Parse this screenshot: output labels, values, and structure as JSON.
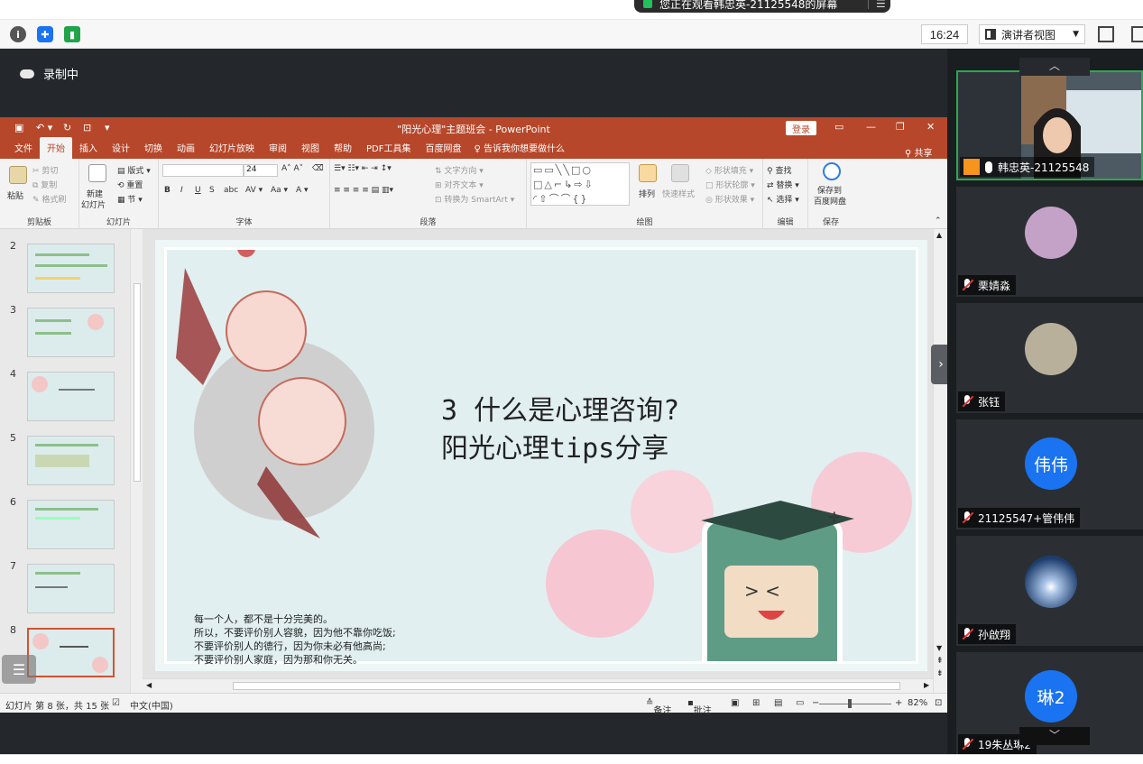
{
  "banner": {
    "text": "您正在观看韩忠英-21125548的屏幕"
  },
  "toolbar": {
    "time": "16:24",
    "view_mode": "演讲者视图"
  },
  "recording": {
    "label": "录制中"
  },
  "ppt": {
    "title": "\"阳光心理\"主题班会  -  PowerPoint",
    "login": "登录",
    "share": "共享",
    "tell_me": "告诉我你想要做什么",
    "tabs": [
      "文件",
      "开始",
      "插入",
      "设计",
      "切换",
      "动画",
      "幻灯片放映",
      "审阅",
      "视图",
      "帮助",
      "PDF工具集",
      "百度网盘"
    ],
    "ribbon": {
      "clipboard": {
        "label": "剪贴板",
        "paste": "粘贴",
        "cut": "剪切",
        "copy": "复制",
        "format_painter": "格式刷"
      },
      "slides": {
        "label": "幻灯片",
        "new_slide": "新建",
        "new_slide2": "幻灯片",
        "layout": "版式",
        "reset": "重置",
        "section": "节"
      },
      "font": {
        "label": "字体",
        "size": "24"
      },
      "paragraph": {
        "label": "段落",
        "text_direction": "文字方向",
        "align_text": "对齐文本",
        "smartart": "转换为 SmartArt"
      },
      "drawing": {
        "label": "绘图",
        "arrange": "排列",
        "quick_styles": "快速样式",
        "shape_fill": "形状填充",
        "shape_outline": "形状轮廓",
        "shape_effects": "形状效果"
      },
      "editing": {
        "label": "编辑",
        "find": "查找",
        "replace": "替换",
        "select": "选择"
      },
      "save": {
        "label": "保存",
        "save_to": "保存到",
        "baidu": "百度网盘"
      }
    },
    "thumbnails": [
      "2",
      "3",
      "4",
      "5",
      "6",
      "7",
      "8"
    ],
    "slide": {
      "title_line1": "3 什么是心理咨询?",
      "title_line2": "阳光心理tips分享",
      "body": [
        "每一个人，都不是十分完美的。",
        "所以，不要评价别人容貌，因为他不靠你吃饭;",
        "不要评价别人的德行，因为你未必有他高尚;",
        "不要评价别人家庭，因为那和你无关。"
      ]
    },
    "status": {
      "slide_info": "幻灯片 第 8 张，共 15 张",
      "language": "中文(中国)",
      "notes": "备注",
      "comments": "批注",
      "zoom": "82%"
    }
  },
  "participants": [
    {
      "name": "韩忠英-21125548",
      "kind": "video",
      "mic": "on"
    },
    {
      "name": "栗婧淼",
      "kind": "photo",
      "mic": "muted"
    },
    {
      "name": "张钰",
      "kind": "photo",
      "mic": "muted"
    },
    {
      "name": "21125547+管伟伟",
      "kind": "initial",
      "initial": "伟伟",
      "mic": "muted"
    },
    {
      "name": "孙啟翔",
      "kind": "photo",
      "mic": "muted"
    },
    {
      "name": "19朱丛琳2",
      "kind": "initial",
      "initial": "琳2",
      "mic": "muted"
    }
  ],
  "colors": {
    "ppt_accent": "#b7472a",
    "active_speaker": "#2ca84f",
    "avatar_blue": "#1a73f0"
  }
}
